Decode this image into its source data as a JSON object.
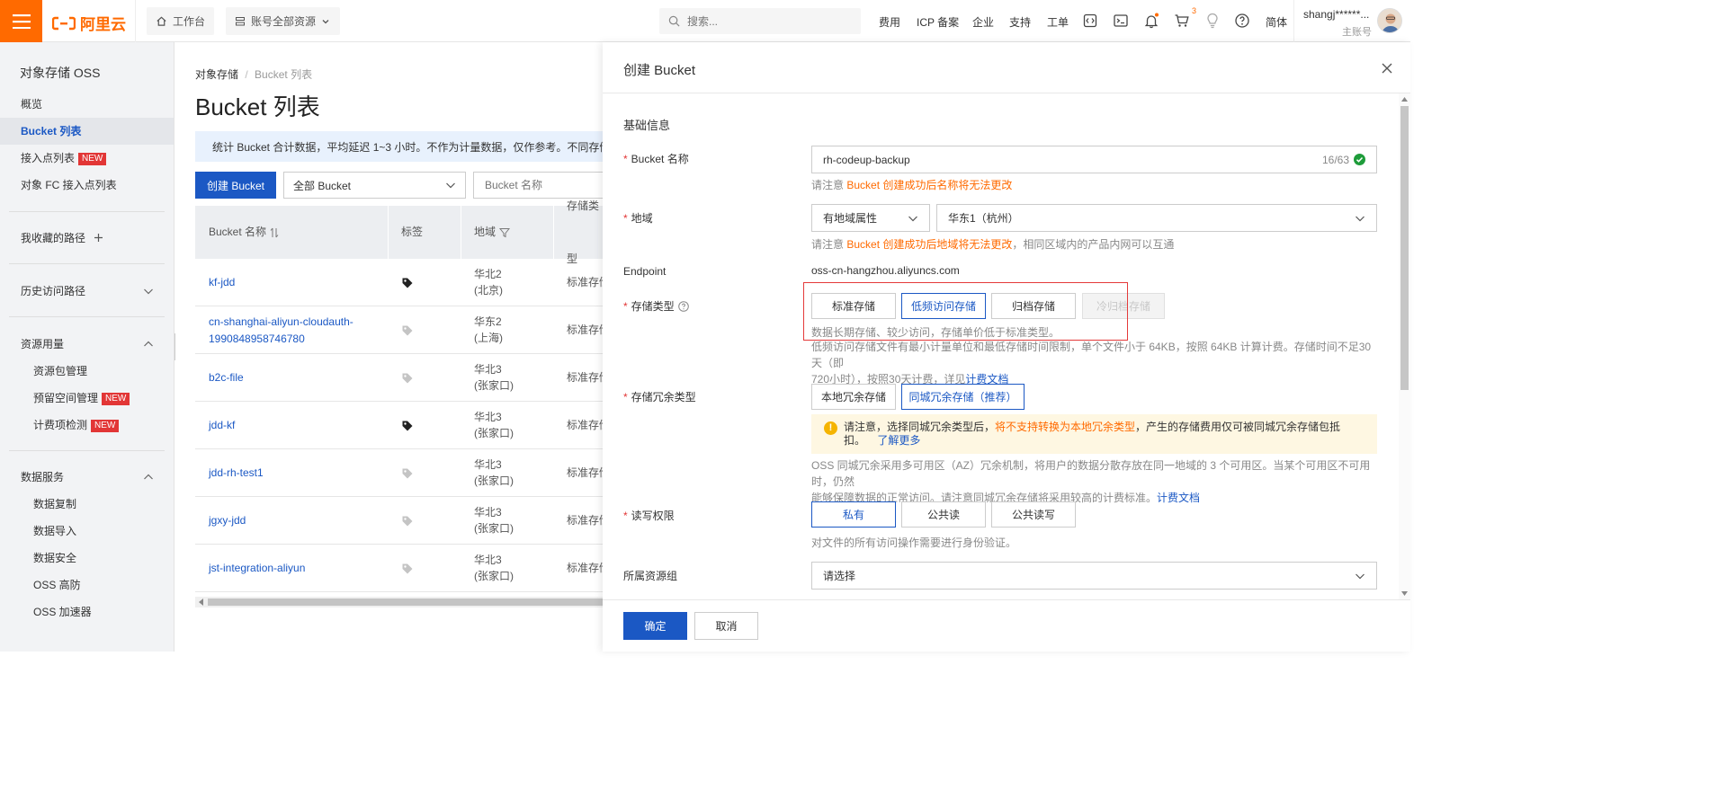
{
  "topbar": {
    "logo_text": "阿里云",
    "workbench": "工作台",
    "account_scope": "账号全部资源",
    "search_placeholder": "搜索...",
    "nav": [
      "费用",
      "ICP 备案",
      "企业",
      "支持",
      "工单"
    ],
    "cart_count": "3",
    "lang": "简体",
    "user_name": "shangj******...",
    "user_role": "主账号",
    "icons": [
      "code-icon",
      "terminal-icon",
      "bell-icon",
      "cart-icon",
      "lightbulb-icon",
      "help-icon"
    ],
    "brand_color": "#ff6a00"
  },
  "sidebar": {
    "title": "对象存储 OSS",
    "items": [
      {
        "label": "概览"
      },
      {
        "label": "Bucket 列表",
        "active": true
      },
      {
        "label": "接入点列表",
        "tag": "NEW"
      },
      {
        "label": "对象 FC 接入点列表"
      },
      {
        "label": "我收藏的路径"
      },
      {
        "label": "历史访问路径"
      },
      {
        "label": "资源用量"
      },
      {
        "label": "资源包管理"
      },
      {
        "label": "预留空间管理",
        "tag": "NEW"
      },
      {
        "label": "计费项检测",
        "tag": "NEW"
      },
      {
        "label": "数据服务"
      },
      {
        "label": "数据复制"
      },
      {
        "label": "数据导入"
      },
      {
        "label": "数据安全"
      },
      {
        "label": "OSS 高防"
      },
      {
        "label": "OSS 加速器"
      }
    ]
  },
  "main": {
    "breadcrumb": [
      "对象存储",
      "Bucket 列表"
    ],
    "title": "Bucket 列表",
    "notice": "统计 Bucket 合计数据，平均延迟 1~3 小时。不作为计量数据，仅作参考。不同存储类",
    "create_button": "创建 Bucket",
    "filter_value": "全部 Bucket",
    "search_placeholder": "Bucket 名称",
    "columns": [
      "Bucket 名称",
      "标签",
      "地域",
      "存储类型"
    ],
    "rows": [
      {
        "name": [
          "kf-jdd"
        ],
        "region": [
          "华北2",
          "(北京)"
        ],
        "type": "标准存储",
        "tagged": true
      },
      {
        "name": [
          "cn-shanghai-aliyun-cloudauth-",
          "1990848958746780"
        ],
        "region": [
          "华东2",
          "(上海)"
        ],
        "type": "标准存储",
        "tagged": false
      },
      {
        "name": [
          "b2c-file"
        ],
        "region": [
          "华北3",
          "(张家口)"
        ],
        "type": "标准存储",
        "tagged": false
      },
      {
        "name": [
          "jdd-kf"
        ],
        "region": [
          "华北3",
          "(张家口)"
        ],
        "type": "标准存储",
        "tagged": true
      },
      {
        "name": [
          "jdd-rh-test1"
        ],
        "region": [
          "华北3",
          "(张家口)"
        ],
        "type": "标准存储",
        "tagged": false
      },
      {
        "name": [
          "jgxy-jdd"
        ],
        "region": [
          "华北3",
          "(张家口)"
        ],
        "type": "标准存储",
        "tagged": false
      },
      {
        "name": [
          "jst-integration-aliyun"
        ],
        "region": [
          "华北3",
          "(张家口)"
        ],
        "type": "标准存储",
        "tagged": false
      }
    ]
  },
  "panel": {
    "title": "创建 Bucket",
    "section": "基础信息",
    "bucket_name": {
      "label": "Bucket 名称",
      "value": "rh-codeup-backup",
      "count": "16/63",
      "hint_prefix": "请注意 ",
      "hint_warn": "Bucket 创建成功后名称将无法更改"
    },
    "region": {
      "label": "地域",
      "attr_value": "有地域属性",
      "region_value": "华东1（杭州）",
      "hint_prefix": "请注意 ",
      "hint_warn": "Bucket 创建成功后地域将无法更改",
      "hint_suffix": "，相同区域内的产品内网可以互通"
    },
    "endpoint": {
      "label": "Endpoint",
      "value": "oss-cn-hangzhou.aliyuncs.com"
    },
    "storage_class": {
      "label": "存储类型",
      "options": [
        "标准存储",
        "低频访问存储",
        "归档存储",
        "冷归档存储"
      ],
      "selected": "低频访问存储",
      "disabled": "冷归档存储",
      "hint1": "数据长期存储、较少访问，存储单价低于标准类型。",
      "hint2_line1": "低频访问存储文件有最小计量单位和最低存储时间限制，单个文件小于 64KB，按照 64KB 计算计费。存储时间不足30天（即",
      "hint2_line2": "720小时），按照30天计费，详见",
      "hint2_link": "计费文档"
    },
    "redundancy": {
      "label": "存储冗余类型",
      "options": [
        "本地冗余存储",
        "同城冗余存储（推荐）"
      ],
      "selected": "同城冗余存储（推荐）",
      "warn_prefix": "请注意，选择同城冗余类型后，",
      "warn_highlight": "将不支持转换为本地冗余类型",
      "warn_suffix": "，产生的存储费用仅可被同城冗余存储包抵扣。",
      "warn_link": "了解更多",
      "desc_line1": "OSS 同城冗余采用多可用区（AZ）冗余机制，将用户的数据分散存放在同一地域的 3 个可用区。当某个可用区不可用时，仍然",
      "desc_line2": "能够保障数据的正常访问。请注意同城冗余存储将采用较高的计费标准。",
      "desc_link": "计费文档"
    },
    "acl": {
      "label": "读写权限",
      "options": [
        "私有",
        "公共读",
        "公共读写"
      ],
      "selected": "私有",
      "hint": "对文件的所有访问操作需要进行身份验证。"
    },
    "resource_group": {
      "label": "所属资源组",
      "placeholder": "请选择"
    },
    "ok": "确定",
    "cancel": "取消",
    "accent_color": "#1b58c4"
  }
}
